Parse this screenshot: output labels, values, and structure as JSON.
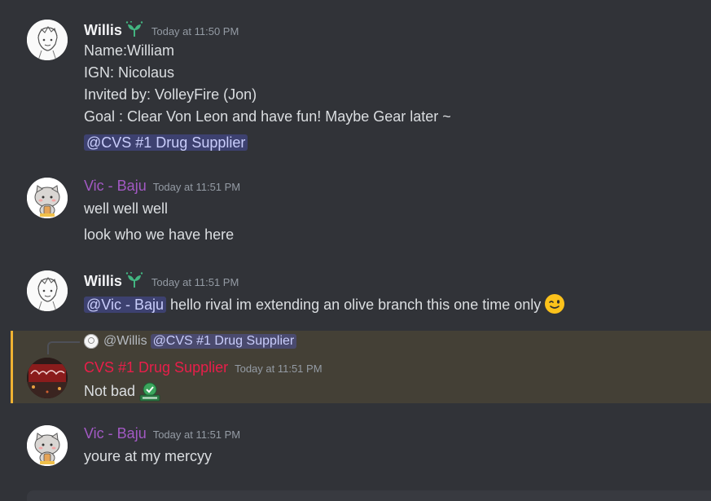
{
  "messages": [
    {
      "author": "Willis",
      "timestamp": "Today at 11:50 PM",
      "lines": [
        "Name:William",
        "IGN: Nicolaus",
        "Invited by: VolleyFire (Jon)",
        "Goal : Clear Von Leon and have fun! Maybe Gear later ~"
      ],
      "mention": "@CVS #1 Drug Supplier"
    },
    {
      "author": "Vic - Baju",
      "timestamp": "Today at 11:51 PM",
      "lines": [
        "well well well",
        "look who we have here"
      ]
    },
    {
      "author": "Willis",
      "timestamp": "Today at 11:51 PM",
      "mention": "@Vic - Baju",
      "text": " hello rival im extending an olive branch this one time only"
    },
    {
      "reply_author": "@Willis",
      "reply_mention": "@CVS #1 Drug Supplier",
      "author": "CVS #1 Drug Supplier",
      "timestamp": "Today at 11:51 PM",
      "text": "Not bad"
    },
    {
      "author": "Vic - Baju",
      "timestamp": "Today at 11:51 PM",
      "text": "youre at my mercyy"
    }
  ],
  "icons": {
    "role": "sprout-icon",
    "emoji": "winking-face-emoji",
    "custom_emoji": "approved-emoji"
  },
  "colors": {
    "background": "#313338",
    "mention_bg": "#3c4270",
    "vic_name": "#a259c3",
    "cvs_name": "#e91e4a",
    "highlight": "#f0b232"
  }
}
